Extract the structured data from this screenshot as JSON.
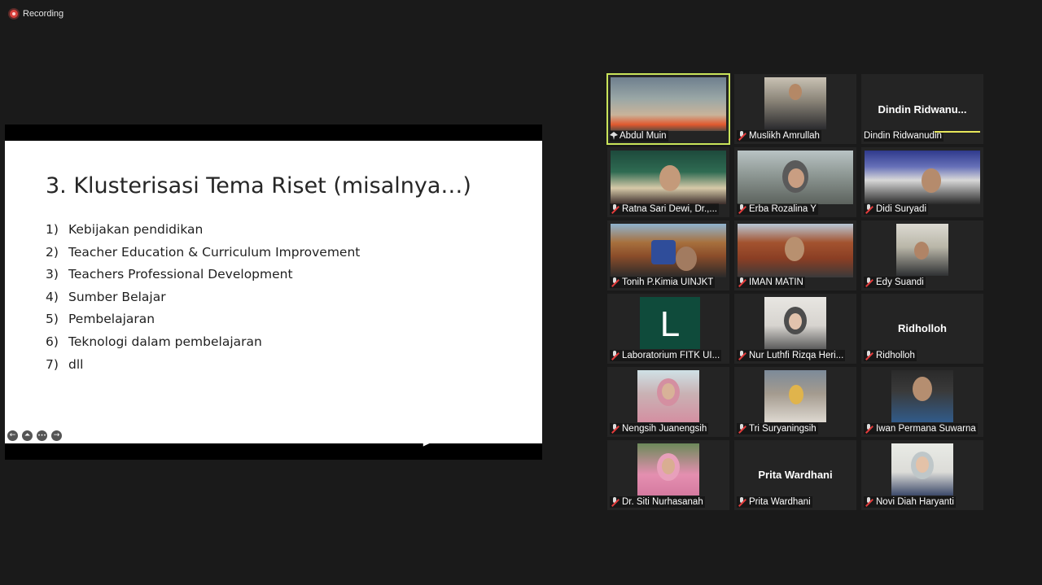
{
  "recording": {
    "label": "Recording"
  },
  "slide": {
    "title": "3. Klusterisasi Tema Riset (misalnya…)",
    "items": [
      {
        "num": "1)",
        "text": "Kebijakan pendidikan"
      },
      {
        "num": "2)",
        "text": "Teacher Education & Curriculum Improvement"
      },
      {
        "num": "3)",
        "text": "Teachers Professional Development"
      },
      {
        "num": "4)",
        "text": "Sumber Belajar"
      },
      {
        "num": "5)",
        "text": "Pembelajaran"
      },
      {
        "num": "6)",
        "text": "Teknologi dalam pembelajaran"
      },
      {
        "num": "7)",
        "text": "dll"
      }
    ],
    "controls": {
      "prev": "←",
      "pointer": "⏶",
      "more": "•••",
      "next": "→"
    }
  },
  "participants": [
    {
      "name": "Abdul Muin",
      "active": true,
      "pinned": true,
      "muted": false
    },
    {
      "name": "Muslikh Amrullah",
      "muted": true
    },
    {
      "name": "Dindin Ridwanudin",
      "center_text": "Dindin  Ridwanu...",
      "muted": false
    },
    {
      "name": "Ratna Sari Dewi, Dr.,...",
      "muted": true
    },
    {
      "name": "Erba Rozalina Y",
      "muted": true
    },
    {
      "name": "Didi Suryadi",
      "muted": true
    },
    {
      "name": "Tonih P.Kimia UINJKT",
      "muted": true
    },
    {
      "name": "IMAN MATIN",
      "muted": true
    },
    {
      "name": "Edy Suandi",
      "muted": true
    },
    {
      "name": "Laboratorium FITK UI...",
      "avatar_letter": "L",
      "muted": true
    },
    {
      "name": "Nur Luthfi Rizqa Heri...",
      "muted": true
    },
    {
      "name": "Ridholloh",
      "center_text": "Ridholloh",
      "muted": true
    },
    {
      "name": "Nengsih Juanengsih",
      "muted": true
    },
    {
      "name": "Tri Suryaningsih",
      "muted": true
    },
    {
      "name": "Iwan Permana Suwarna",
      "muted": true
    },
    {
      "name": "Dr. Siti Nurhasanah",
      "muted": true
    },
    {
      "name": "Prita Wardhani",
      "center_text": "Prita Wardhani",
      "muted": true
    },
    {
      "name": "Novi Diah Haryanti",
      "muted": true
    }
  ],
  "colors": {
    "active_border": "#c9e45a",
    "recording": "#d8403b",
    "muted_mic": "#e23c3c"
  }
}
